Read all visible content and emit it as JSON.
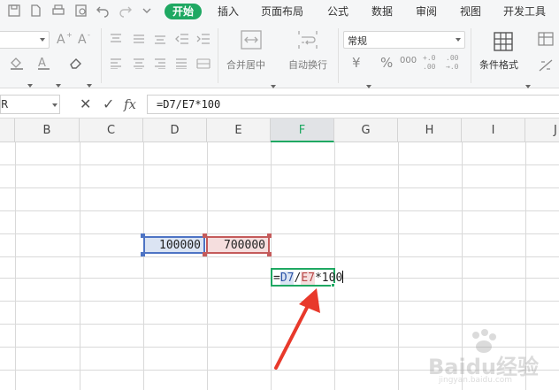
{
  "tabs": [
    {
      "label": "开始",
      "active": true
    },
    {
      "label": "插入"
    },
    {
      "label": "页面布局"
    },
    {
      "label": "公式"
    },
    {
      "label": "数据"
    },
    {
      "label": "审阅"
    },
    {
      "label": "视图"
    },
    {
      "label": "开发工具"
    }
  ],
  "ribbon": {
    "merge_label": "合并居中",
    "wrap_label": "自动换行",
    "number_format": "常规",
    "cond_format_label": "条件格式",
    "currency_symbol": "¥",
    "percent_symbol": "%",
    "thousands_symbol": "000",
    "inc_decimal": "+.0\n.00",
    "dec_decimal": ".00\n→.0"
  },
  "formula_bar": {
    "name_box": "R",
    "cancel": "✕",
    "confirm": "✓",
    "fx": "fx",
    "formula": "=D7/E7*100"
  },
  "columns": [
    "B",
    "C",
    "D",
    "E",
    "F",
    "G",
    "H",
    "I",
    "J"
  ],
  "active_column": "F",
  "cells": {
    "D7": "100000",
    "E7": "700000",
    "F8_editing": {
      "eq": "=",
      "ref1": "D7",
      "op1": "/",
      "ref2": "E7",
      "rest": "*100"
    }
  },
  "colors": {
    "accent": "#1fa862",
    "ref_d7_border": "#4e74c4",
    "ref_d7_fill": "#dbe4f3",
    "ref_e7_border": "#c45b5b",
    "ref_e7_fill": "#f5dede",
    "arrow": "#e8392b"
  },
  "watermark": {
    "text": "Baidu经验",
    "url": "jingyan.baidu.com"
  }
}
